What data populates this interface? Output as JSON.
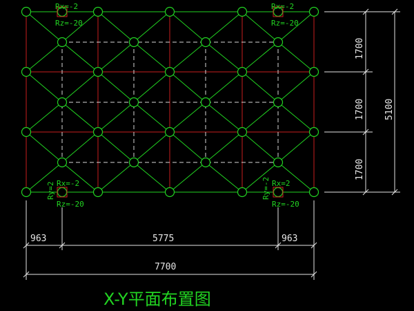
{
  "title": "X-Y平面布置图",
  "colors": {
    "background": "#000000",
    "grid_lines": "#c81e1e",
    "members": "#22d422",
    "nodes": "#22d422",
    "lower_chords": "#d8d8d8",
    "dimensions": "#e6e6e6",
    "support_marker": "#d22020"
  },
  "dimensions": {
    "bottom_row1": [
      "963",
      "5775",
      "963"
    ],
    "bottom_total": "7700",
    "right_segments": [
      "1700",
      "1700",
      "1700"
    ],
    "right_total": "5100"
  },
  "reactions": {
    "top_left": {
      "rx": "Rx=-2",
      "rz": "Rz=-20"
    },
    "top_right": {
      "rx": "Rx=-2",
      "rz": "Rz=-20"
    },
    "bottom_left": {
      "rx": "Rx=-2",
      "rz": "Rz=-20",
      "ry": "Ry=2"
    },
    "bottom_right": {
      "rx": "Rx=2",
      "rz": "Rz=-20",
      "ry": "Ry=-2"
    }
  }
}
